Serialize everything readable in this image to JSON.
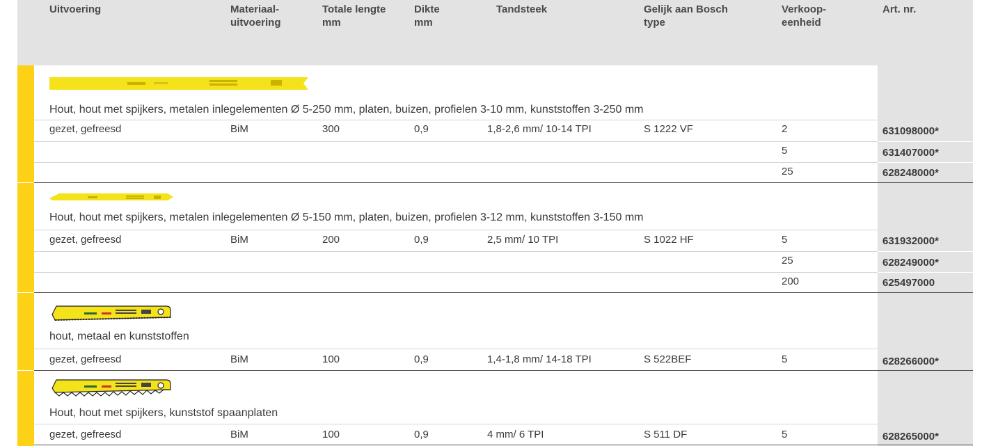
{
  "header": {
    "uitvoering": "Uitvoering",
    "materiaal": "Materiaal-\nuitvoering",
    "lengte": "Totale lengte\nmm",
    "dikte": "Dikte\nmm",
    "tandsteek": "Tandsteek",
    "bosch": "Gelijk aan Bosch\ntype",
    "verkoop": "Verkoop-\neenheid",
    "artnr": "Art. nr."
  },
  "groups": [
    {
      "blade_image": "saw-blade-300mm",
      "description": "Hout, hout met spijkers, metalen inlegelementen Ø 5-250 mm, platen, buizen, profielen 3-10 mm, kunststoffen 3-250 mm",
      "rows": [
        {
          "uitvoering": "gezet, gefreesd",
          "materiaal": "BiM",
          "lengte": "300",
          "dikte": "0,9",
          "tandsteek": "1,8-2,6 mm/ 10-14 TPI",
          "bosch": "S 1222 VF",
          "verkoop": "2",
          "artnr": "631098000*"
        },
        {
          "uitvoering": "",
          "materiaal": "",
          "lengte": "",
          "dikte": "",
          "tandsteek": "",
          "bosch": "",
          "verkoop": "5",
          "artnr": "631407000*"
        },
        {
          "uitvoering": "",
          "materiaal": "",
          "lengte": "",
          "dikte": "",
          "tandsteek": "",
          "bosch": "",
          "verkoop": "25",
          "artnr": "628248000*"
        }
      ]
    },
    {
      "blade_image": "saw-blade-200mm",
      "description": "Hout, hout met spijkers, metalen inlegelementen Ø 5-150 mm, platen, buizen, profielen 3-12 mm, kunststoffen 3-150 mm",
      "rows": [
        {
          "uitvoering": "gezet, gefreesd",
          "materiaal": "BiM",
          "lengte": "200",
          "dikte": "0,9",
          "tandsteek": "2,5 mm/ 10 TPI",
          "bosch": "S 1022 HF",
          "verkoop": "5",
          "artnr": "631932000*"
        },
        {
          "uitvoering": "",
          "materiaal": "",
          "lengte": "",
          "dikte": "",
          "tandsteek": "",
          "bosch": "",
          "verkoop": "25",
          "artnr": "628249000*"
        },
        {
          "uitvoering": "",
          "materiaal": "",
          "lengte": "",
          "dikte": "",
          "tandsteek": "",
          "bosch": "",
          "verkoop": "200",
          "artnr": "625497000"
        }
      ]
    },
    {
      "blade_image": "saw-blade-100mm-fine",
      "description": "hout, metaal en kunststoffen",
      "rows": [
        {
          "uitvoering": "gezet, gefreesd",
          "materiaal": "BiM",
          "lengte": "100",
          "dikte": "0,9",
          "tandsteek": "1,4-1,8 mm/ 14-18 TPI",
          "bosch": "S 522BEF",
          "verkoop": "5",
          "artnr": "628266000*"
        }
      ]
    },
    {
      "blade_image": "saw-blade-100mm-coarse",
      "description": "Hout, hout met spijkers, kunststof spaanplaten",
      "rows": [
        {
          "uitvoering": "gezet, gefreesd",
          "materiaal": "BiM",
          "lengte": "100",
          "dikte": "0,9",
          "tandsteek": "4 mm/ 6 TPI",
          "bosch": "S 511 DF",
          "verkoop": "5",
          "artnr": "628265000*"
        }
      ]
    }
  ],
  "colors": {
    "accent_yellow": "#fcd116",
    "header_gray": "#e3e3e3"
  }
}
